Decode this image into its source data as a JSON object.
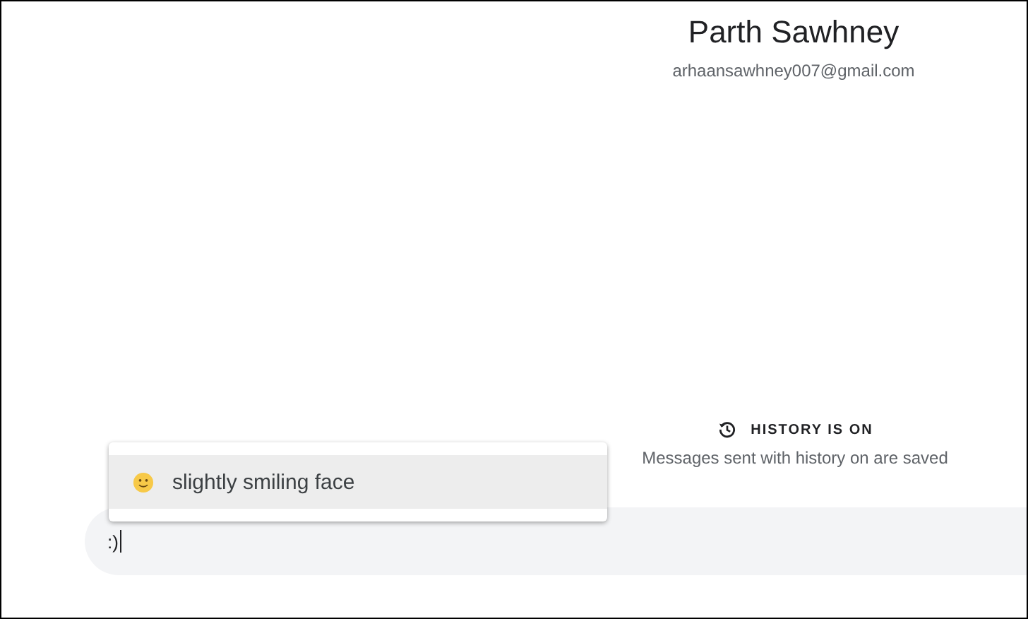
{
  "profile": {
    "name": "Parth Sawhney",
    "email": "arhaansawhney007@gmail.com"
  },
  "history": {
    "title": "HISTORY IS ON",
    "description": "Messages sent with history on are saved"
  },
  "suggestions": [
    {
      "label": "slightly smiling face",
      "selected": true
    }
  ],
  "composer": {
    "value": ":)"
  }
}
